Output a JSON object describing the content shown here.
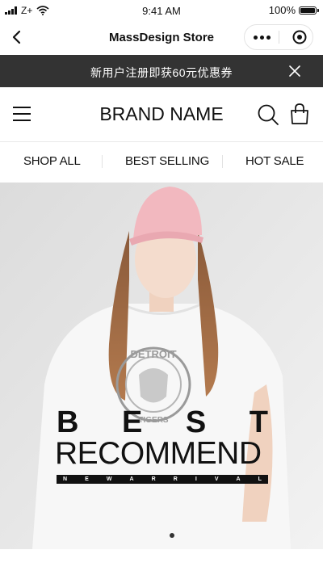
{
  "status_bar": {
    "carrier": "Z+",
    "time": "9:41 AM",
    "battery": "100%",
    "icons": [
      "signal-icon",
      "wifi-icon",
      "battery-icon"
    ]
  },
  "nav": {
    "title": "MassDesign Store",
    "icons": [
      "back-arrow-icon",
      "more-dots-icon",
      "target-close-icon"
    ]
  },
  "promo": {
    "text": "新用户注册即获60元优惠券",
    "icons": [
      "close-icon"
    ]
  },
  "header": {
    "brand": "BRAND NAME",
    "icons": [
      "menu-icon",
      "search-icon",
      "shopping-bag-icon"
    ]
  },
  "tabs": [
    {
      "label": "SHOP ALL"
    },
    {
      "label": "BEST SELLING"
    },
    {
      "label": "HOT SALE"
    }
  ],
  "hero": {
    "best_letters": [
      "B",
      "E",
      "S",
      "T"
    ],
    "headline": "RECOMMEND",
    "arrival_letters": [
      "N",
      "E",
      "W",
      "A",
      "R",
      "R",
      "I",
      "V",
      "A",
      "L"
    ],
    "shirt_print_top": "DETROIT",
    "shirt_print_bottom": "TIGERS",
    "carousel_active_index": 1
  },
  "colors": {
    "promo_bg": "#333333",
    "cap": "#f2b8bf",
    "hero_bg": "#e6e6e6"
  }
}
